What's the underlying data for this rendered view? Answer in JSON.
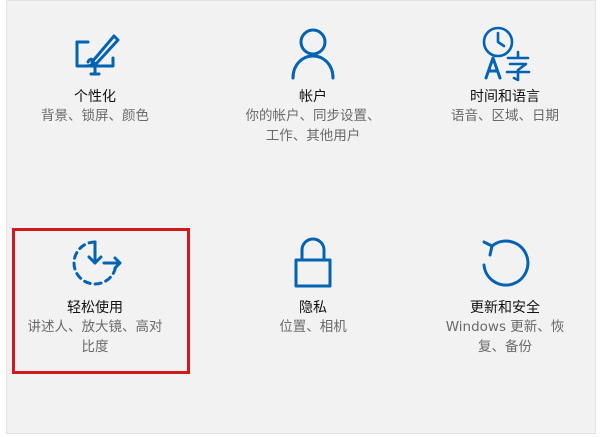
{
  "accent_color": "#0063b1",
  "highlight_color": "#d11919",
  "tiles": [
    {
      "icon": "personalization-icon",
      "title": "个性化",
      "desc": "背景、锁屏、颜色"
    },
    {
      "icon": "account-icon",
      "title": "帐户",
      "desc": "你的帐户、同步设置、\n工作、其他用户"
    },
    {
      "icon": "time-language-icon",
      "title": "时间和语言",
      "desc": "语音、区域、日期"
    },
    {
      "icon": "ease-of-access-icon",
      "title": "轻松使用",
      "desc": "讲述人、放大镜、高对\n比度"
    },
    {
      "icon": "privacy-lock-icon",
      "title": "隐私",
      "desc": "位置、相机"
    },
    {
      "icon": "update-security-icon",
      "title": "更新和安全",
      "desc": "Windows 更新、恢\n复、备份"
    }
  ]
}
